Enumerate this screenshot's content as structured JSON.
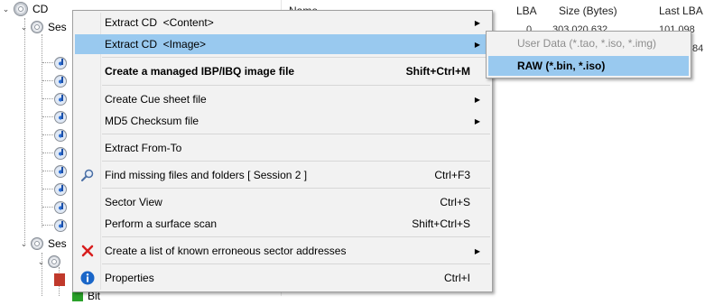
{
  "tree": {
    "root_label": "CD",
    "session1_label": "Ses",
    "session2_label": "Ses",
    "bottom_label": "Bit"
  },
  "list": {
    "columns": [
      "Name",
      "LBA",
      "Size (Bytes)",
      "Last LBA"
    ],
    "peek_row_1": [
      "0",
      "303 020 632",
      "101 098"
    ],
    "peek_row_2_last": "84"
  },
  "menu": {
    "items": [
      {
        "label": "Extract CD  <Content>",
        "shortcut": "",
        "submenu": true
      },
      {
        "label": "Extract CD  <Image>",
        "shortcut": "",
        "submenu": true
      },
      {
        "label": "Create a managed IBP/IBQ image file",
        "shortcut": "Shift+Ctrl+M"
      },
      {
        "label": "Create Cue sheet file",
        "shortcut": "",
        "submenu": true
      },
      {
        "label": "MD5 Checksum file",
        "shortcut": "",
        "submenu": true
      },
      {
        "label": "Extract From-To",
        "shortcut": ""
      },
      {
        "label": "Find missing files and folders [ Session 2 ]",
        "shortcut": "Ctrl+F3"
      },
      {
        "label": "Sector View",
        "shortcut": "Ctrl+S"
      },
      {
        "label": "Perform a surface scan",
        "shortcut": "Shift+Ctrl+S"
      },
      {
        "label": "Create a list of known erroneous sector addresses",
        "shortcut": "",
        "submenu": true
      },
      {
        "label": "Properties",
        "shortcut": "Ctrl+I"
      }
    ],
    "arrow_glyph": "▶"
  },
  "submenu": {
    "items": [
      {
        "label": "User Data (*.tao, *.iso, *.img)",
        "disabled": true
      },
      {
        "label": "RAW (*.bin, *.iso)",
        "highlighted": true
      }
    ]
  },
  "icons": {
    "search": "magnifier-icon",
    "error": "red-x-icon",
    "info": "info-icon"
  },
  "colors": {
    "highlight": "#99c9ef",
    "menu_bg": "#f2f2f2",
    "error_red": "#d81e1e",
    "info_blue": "#1a66c8"
  }
}
